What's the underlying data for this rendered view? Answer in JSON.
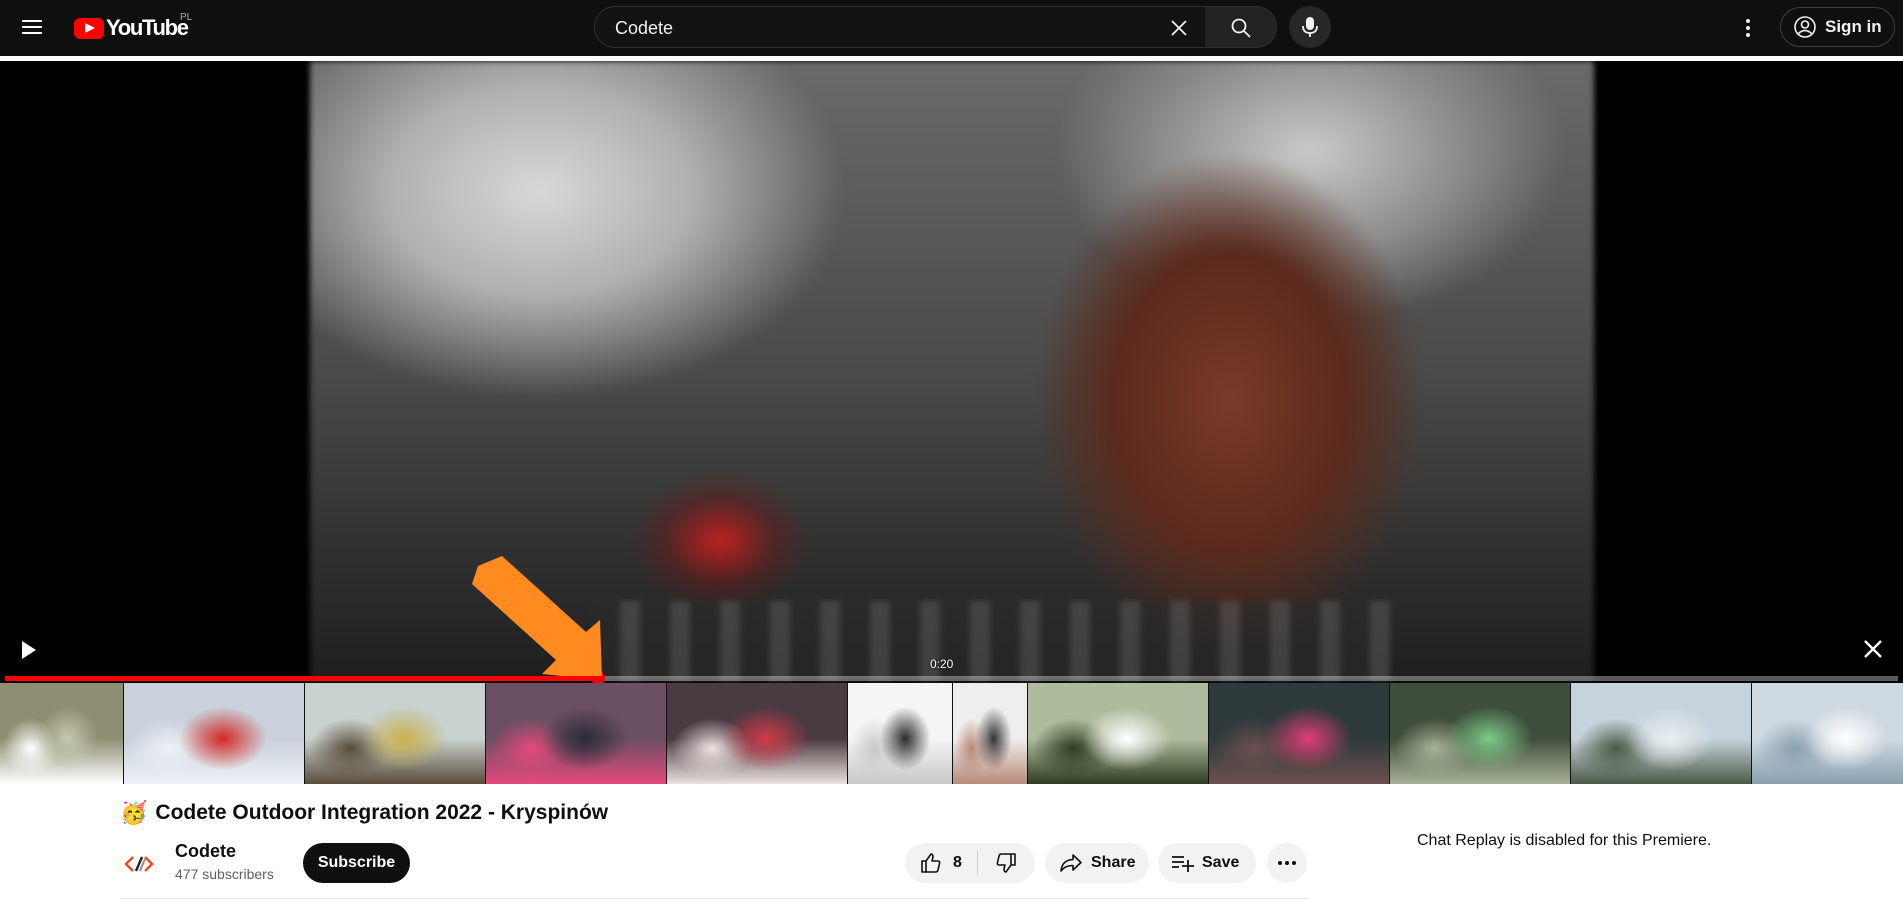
{
  "masthead": {
    "logo_text": "YouTube",
    "country_code": "PL",
    "search": {
      "value": "Codete",
      "placeholder": "Search"
    },
    "signin_label": "Sign in",
    "icons": [
      "menu-icon",
      "clear-icon",
      "search-icon",
      "mic-icon",
      "more-vert-icon",
      "account-icon"
    ]
  },
  "player": {
    "hover_time": "0:20",
    "progress_fraction": 0.313,
    "accent_color": "#ff0000",
    "storyboard_frames": [
      {
        "desc": "lake-volleyball",
        "colors": [
          "#8e8f72",
          "#c5c7b0",
          "#ffffff"
        ]
      },
      {
        "desc": "red-shirt-dancer",
        "colors": [
          "#c9d1dc",
          "#d42a22",
          "#eef1f5"
        ]
      },
      {
        "desc": "outdoor-dancers",
        "colors": [
          "#c8d2cf",
          "#c9b04a",
          "#5a4c3a"
        ]
      },
      {
        "desc": "party-tent-crowd",
        "colors": [
          "#6b4f62",
          "#2b2b38",
          "#e34a7c"
        ]
      },
      {
        "desc": "party-tent-crowd-2",
        "colors": [
          "#4a3a42",
          "#d23a4a",
          "#ece2df"
        ]
      },
      {
        "desc": "dj-mixer",
        "colors": [
          "#f5f5f5",
          "#2a2a2a",
          "#c8c8c8"
        ]
      },
      {
        "desc": "dj-hand",
        "colors": [
          "#eeeeee",
          "#333333",
          "#b98a78"
        ]
      },
      {
        "desc": "dj-headphones",
        "colors": [
          "#aebb9c",
          "#ffffff",
          "#2d3d22"
        ]
      },
      {
        "desc": "night-dance",
        "colors": [
          "#2e3a3a",
          "#e23e78",
          "#6c5050"
        ]
      },
      {
        "desc": "night-dance-2",
        "colors": [
          "#3f4e3c",
          "#7ccc8a",
          "#a7b397"
        ]
      },
      {
        "desc": "wakeboard",
        "colors": [
          "#c7d3dc",
          "#e9eef1",
          "#4b5a46"
        ]
      },
      {
        "desc": "wakeboard-2",
        "colors": [
          "#cfd9e1",
          "#ffffff",
          "#8aa0b0"
        ]
      }
    ]
  },
  "video": {
    "title_emoji": "🥳",
    "title": "Codete Outdoor Integration 2022 - Kryspinów",
    "channel": {
      "name": "Codete",
      "subscribers": "477 subscribers"
    },
    "subscribe_label": "Subscribe",
    "likes": "8",
    "share_label": "Share",
    "save_label": "Save"
  },
  "chat": {
    "message": "Chat Replay is disabled for this Premiere."
  }
}
